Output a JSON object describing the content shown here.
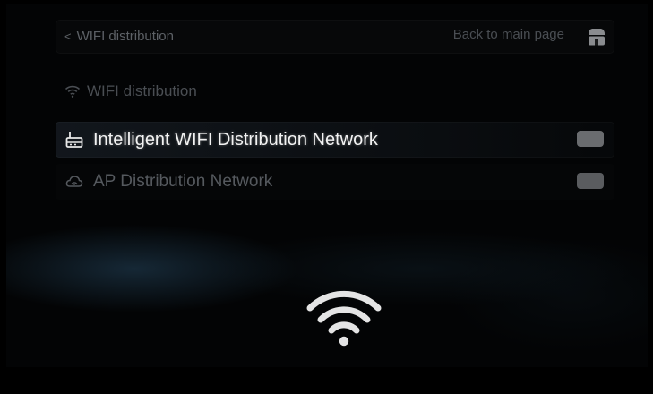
{
  "header": {
    "back_label": "WIFI distribution",
    "main_page_label": "Back to main page",
    "home_icon": "home-icon"
  },
  "section": {
    "title": "WIFI distribution",
    "icon": "wifi-icon"
  },
  "options": [
    {
      "label": "Intelligent WIFI Distribution Network",
      "icon": "router-icon",
      "selected": true,
      "toggle": "off"
    },
    {
      "label": "AP Distribution Network",
      "icon": "cloud-icon",
      "selected": false,
      "toggle": "off"
    }
  ],
  "center_icon": "wifi-icon",
  "colors": {
    "background": "#030405",
    "selected_text": "#f2f2f2",
    "dim_text": "#55595e"
  }
}
